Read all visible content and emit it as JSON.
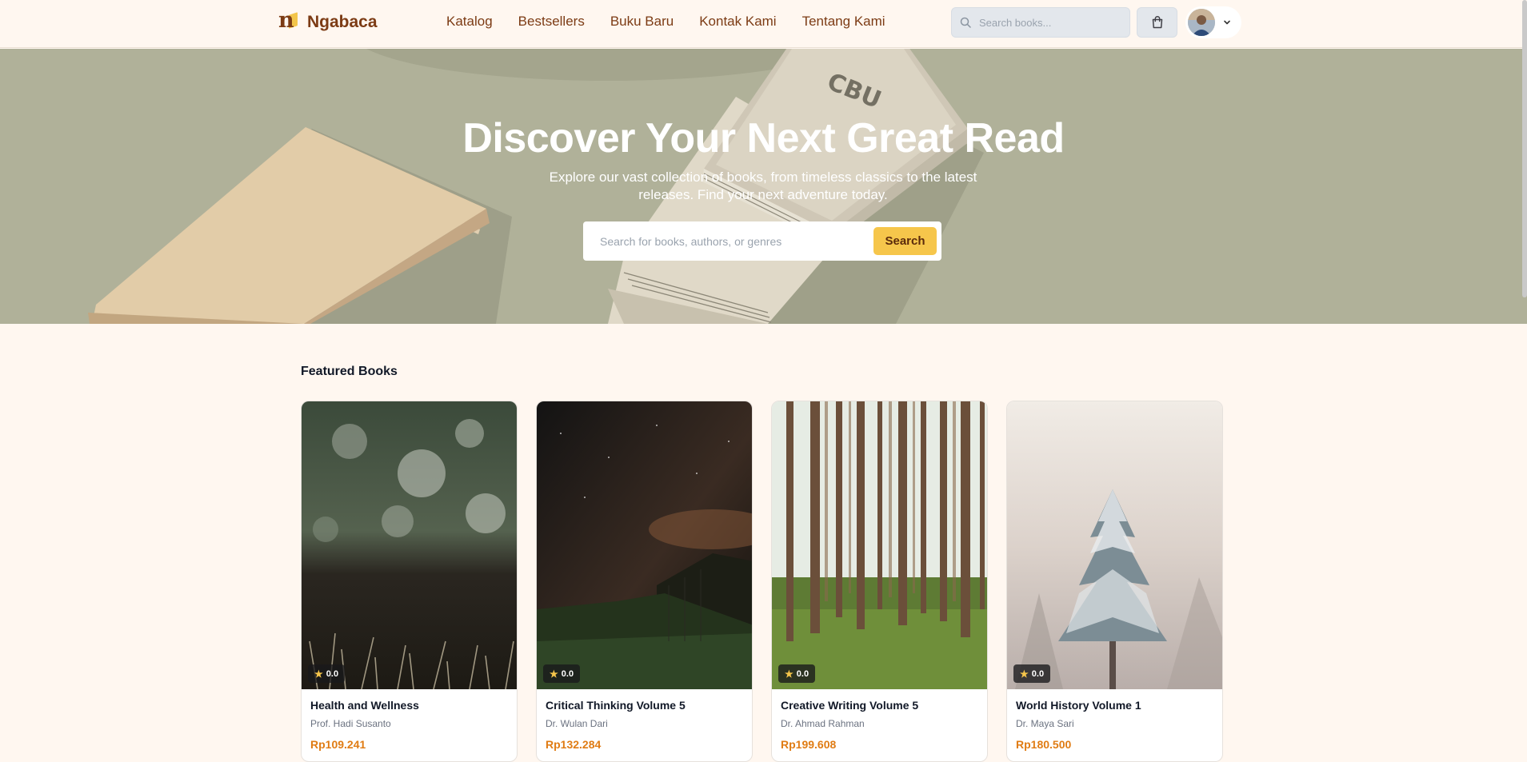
{
  "brand": {
    "name": "Ngabaca",
    "logo_letter": "n"
  },
  "nav": [
    {
      "label": "Katalog"
    },
    {
      "label": "Bestsellers"
    },
    {
      "label": "Buku Baru"
    },
    {
      "label": "Kontak Kami"
    },
    {
      "label": "Tentang Kami"
    }
  ],
  "header_search": {
    "placeholder": "Search books..."
  },
  "icons": {
    "search": "search-icon",
    "cart": "shopping-bag-icon",
    "user_menu": "chevron-down-icon",
    "rating": "star-icon"
  },
  "hero": {
    "title": "Discover Your Next Great Read",
    "subtitle": "Explore our vast collection of books, from timeless classics to the latest releases. Find your next adventure today.",
    "search_placeholder": "Search for books, authors, or genres",
    "search_button": "Search"
  },
  "featured": {
    "title": "Featured Books",
    "books": [
      {
        "title": "Health and Wellness",
        "author": "Prof. Hadi Susanto",
        "price": "Rp109.241",
        "rating": "0.0"
      },
      {
        "title": "Critical Thinking Volume 5",
        "author": "Dr. Wulan Dari",
        "price": "Rp132.284",
        "rating": "0.0"
      },
      {
        "title": "Creative Writing Volume 5",
        "author": "Dr. Ahmad Rahman",
        "price": "Rp199.608",
        "rating": "0.0"
      },
      {
        "title": "World History Volume 1",
        "author": "Dr. Maya Sari",
        "price": "Rp180.500",
        "rating": "0.0"
      }
    ]
  },
  "colors": {
    "page_bg": "#fff7f0",
    "brand": "#7c3b14",
    "accent": "#f6c64b",
    "price": "#e07c14"
  }
}
